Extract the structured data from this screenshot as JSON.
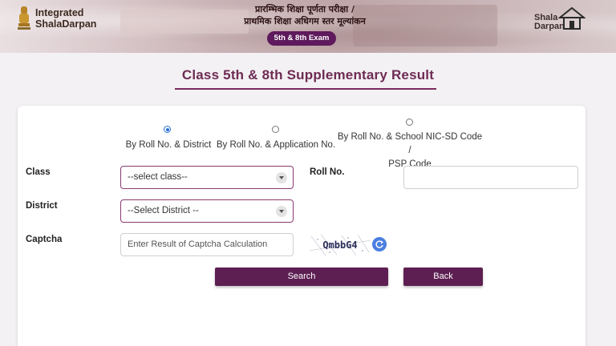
{
  "header": {
    "brand_line1": "Integrated",
    "brand_line2": "ShalaDarpan",
    "title_line1": "प्रारम्भिक शिक्षा पूर्णता परीक्षा /",
    "title_line2": "प्राथमिक शिक्षा अधिगम स्तर मूल्यांकन",
    "exam_badge": "5th & 8th Exam",
    "right_logo_line1": "Shala",
    "right_logo_line2": "Darpan"
  },
  "page_title": "Class 5th & 8th Supplementary Result",
  "search_mode": {
    "options": [
      {
        "label": "By Roll No. & District",
        "checked": true
      },
      {
        "label": "By Roll No. & Application No.",
        "checked": false
      },
      {
        "label_line1": "By Roll No. & School NIC-SD Code /",
        "label_line2": "PSP Code",
        "checked": false
      }
    ]
  },
  "form": {
    "class_label": "Class",
    "class_value": "--select class--",
    "roll_label": "Roll No.",
    "roll_value": "",
    "district_label": "District",
    "district_value": "--Select District --",
    "captcha_label": "Captcha",
    "captcha_placeholder": "Enter Result of Captcha Calculation",
    "captcha_text": "QmbbG4"
  },
  "buttons": {
    "search": "Search",
    "back": "Back"
  },
  "colors": {
    "accent": "#5d1f52",
    "title": "#6e2b53",
    "radio_checked": "#2a6fd6"
  }
}
